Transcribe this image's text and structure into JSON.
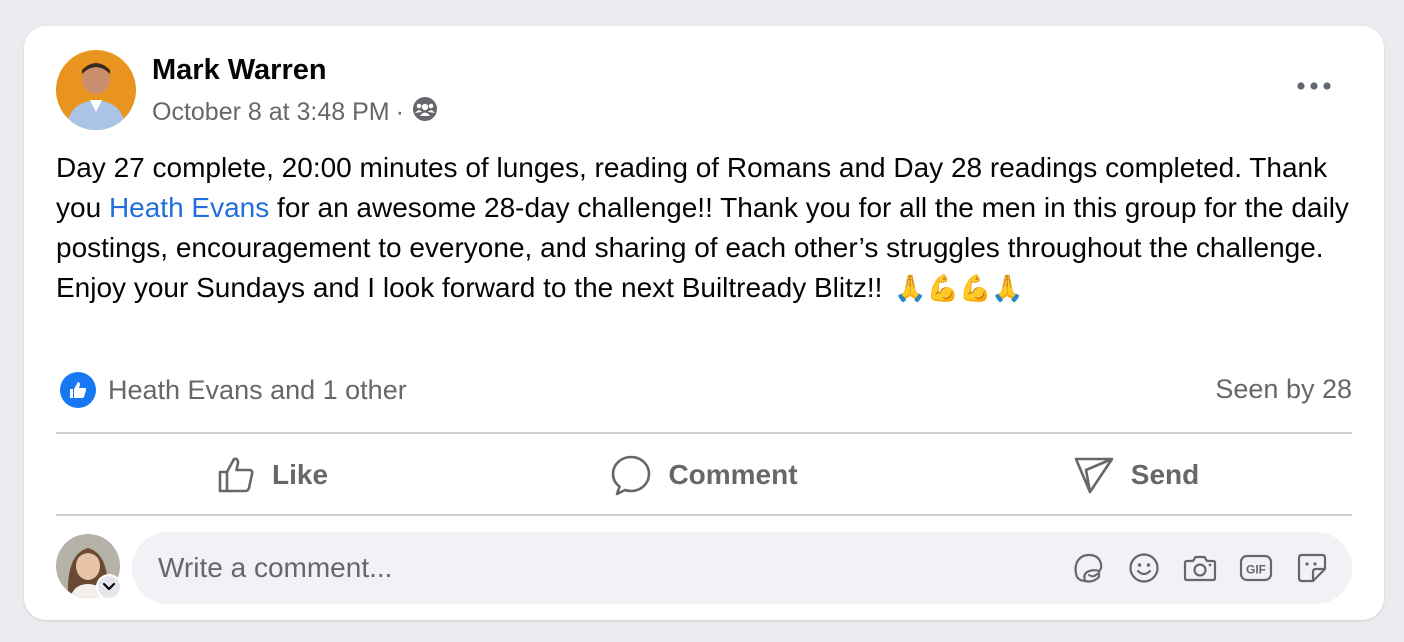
{
  "post": {
    "author": "Mark Warren",
    "timestamp": "October 8 at 3:48 PM",
    "separator": "·",
    "audience_icon": "group-audience-icon",
    "text": {
      "part1": "Day 27 complete, 20:00 minutes of lunges, reading of Romans and Day 28 readings completed. Thank you ",
      "mention": "Heath Evans",
      "part2": " for an awesome 28-day challenge!! Thank you for all the men in this group for the daily postings, encouragement to everyone, and sharing of each other’s struggles throughout the challenge. Enjoy your Sundays and I look forward to the next Builtready Blitz!! ",
      "emojis": "🙏💪💪🙏"
    },
    "reactions_summary": "Heath Evans and 1 other",
    "seen_by": "Seen by 28"
  },
  "actions": {
    "like": "Like",
    "comment": "Comment",
    "send": "Send"
  },
  "composer": {
    "placeholder": "Write a comment...",
    "tools": [
      "avatar-sticker-icon",
      "emoji-icon",
      "camera-icon",
      "gif-icon",
      "sticker-icon"
    ]
  },
  "colors": {
    "accent": "#1877f2",
    "mention": "#216fdb",
    "secondary_text": "#65676b",
    "background": "#e9ebee"
  }
}
